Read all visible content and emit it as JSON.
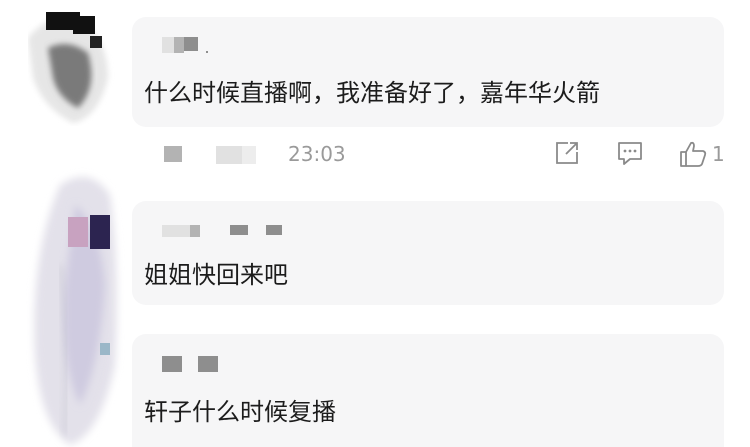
{
  "comments": [
    {
      "text": "什么时候直播啊，我准备好了，嘉年华火箭",
      "time": "23:03",
      "like_count": "1",
      "actions": {
        "share_icon": "share-icon",
        "reply_icon": "comment-icon",
        "like_icon": "thumbs-up-icon"
      }
    },
    {
      "text": "姐姐快回来吧"
    },
    {
      "text": "轩子什么时候复播"
    }
  ],
  "colors": {
    "bubble": "#f6f6f7",
    "text": "#1c1c1c",
    "meta": "#9a9a9a",
    "icon": "#8a8a8a"
  }
}
